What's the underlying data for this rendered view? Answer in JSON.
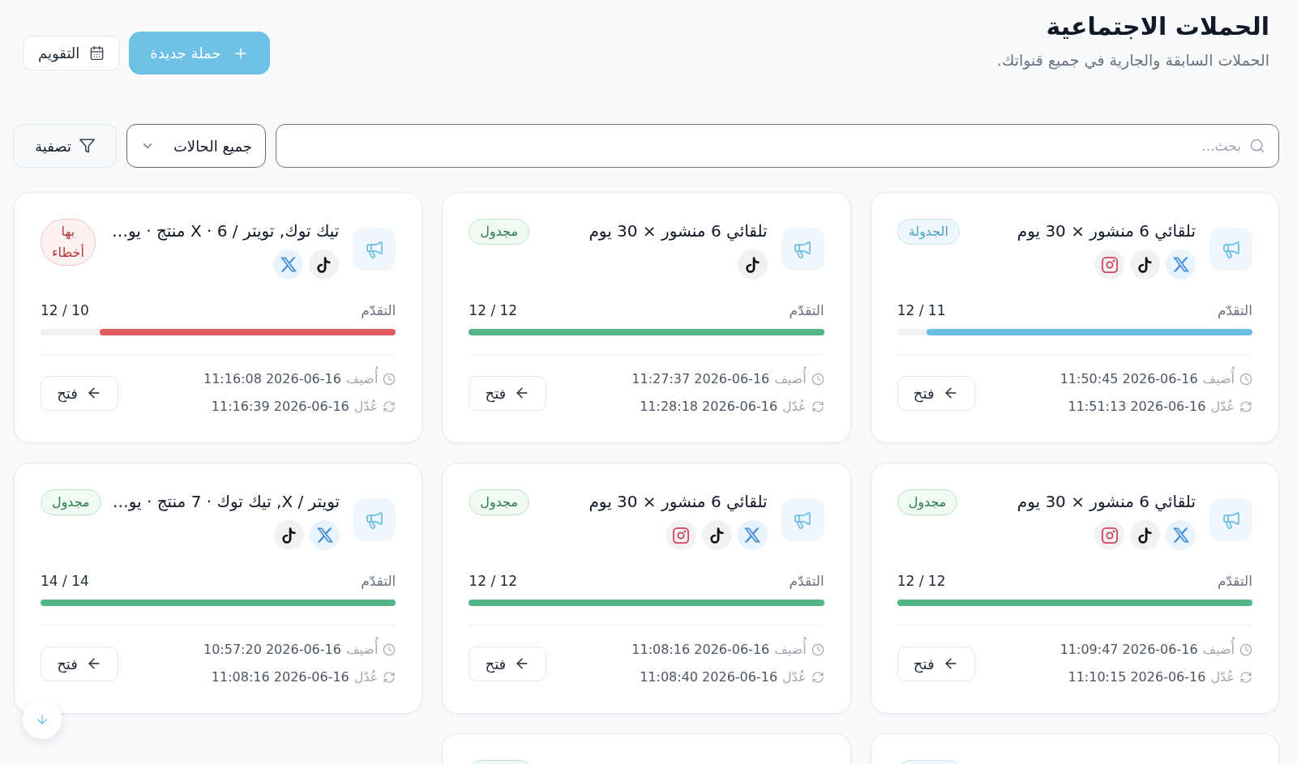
{
  "header": {
    "title": "الحملات الاجتماعية",
    "subtitle": "الحملات السابقة والجارية في جميع قنواتك.",
    "buttons": [
      {
        "kind": "primary",
        "label": "حملة جديدة"
      },
      {
        "kind": "secondary",
        "label": "التقويم"
      }
    ]
  },
  "filters": {
    "search": {
      "placeholder": "بحث..."
    },
    "status_filter": {
      "value": "جميع الحالات"
    },
    "filter_button": {
      "label": "تصفية"
    }
  },
  "cards": [
    {
      "title": "تلقائي 6 منشور × 30 يوم",
      "channels": [
        {
          "kind": "x"
        },
        {
          "kind": "tiktok"
        },
        {
          "kind": "instagram"
        }
      ],
      "status": {
        "kind": "scheduling",
        "label": "الجدولة"
      },
      "progress": {
        "label": "التقدّم",
        "value": "11 / 12",
        "level": 0.917
      },
      "created": {
        "label": "أُضيف",
        "value": "2026-06-16 11:50:45"
      },
      "updated": {
        "label": "عُدّل",
        "value": "2026-06-16 11:51:13"
      },
      "open_button": {
        "label": "فتح"
      }
    },
    {
      "title": "تلقائي 6 منشور × 30 يوم",
      "channels": [
        {
          "kind": "tiktok"
        }
      ],
      "status": {
        "kind": "scheduled",
        "label": "مجدول"
      },
      "progress": {
        "label": "التقدّم",
        "value": "12 / 12",
        "level": 1
      },
      "created": {
        "label": "أُضيف",
        "value": "2026-06-16 11:27:37"
      },
      "updated": {
        "label": "عُدّل",
        "value": "2026-06-16 11:28:18"
      },
      "open_button": {
        "label": "فتح"
      }
    },
    {
      "title": "تيك توك, تويتر / X · 6 منتج · يو…",
      "channels": [
        {
          "kind": "tiktok"
        },
        {
          "kind": "x"
        }
      ],
      "status": {
        "kind": "error",
        "label": "بها أخطاء"
      },
      "progress": {
        "label": "التقدّم",
        "value": "10 / 12",
        "level": 0.833
      },
      "created": {
        "label": "أُضيف",
        "value": "2026-06-16 11:16:08"
      },
      "updated": {
        "label": "عُدّل",
        "value": "2026-06-16 11:16:39"
      },
      "open_button": {
        "label": "فتح"
      }
    },
    {
      "title": "تلقائي 6 منشور × 30 يوم",
      "channels": [
        {
          "kind": "x"
        },
        {
          "kind": "tiktok"
        },
        {
          "kind": "instagram"
        }
      ],
      "status": {
        "kind": "scheduled",
        "label": "مجدول"
      },
      "progress": {
        "label": "التقدّم",
        "value": "12 / 12",
        "level": 1
      },
      "created": {
        "label": "أُضيف",
        "value": "2026-06-16 11:09:47"
      },
      "updated": {
        "label": "عُدّل",
        "value": "2026-06-16 11:10:15"
      },
      "open_button": {
        "label": "فتح"
      }
    },
    {
      "title": "تلقائي 6 منشور × 30 يوم",
      "channels": [
        {
          "kind": "x"
        },
        {
          "kind": "tiktok"
        },
        {
          "kind": "instagram"
        }
      ],
      "status": {
        "kind": "scheduled",
        "label": "مجدول"
      },
      "progress": {
        "label": "التقدّم",
        "value": "12 / 12",
        "level": 1
      },
      "created": {
        "label": "أُضيف",
        "value": "2026-06-16 11:08:16"
      },
      "updated": {
        "label": "عُدّل",
        "value": "2026-06-16 11:08:40"
      },
      "open_button": {
        "label": "فتح"
      }
    },
    {
      "title": "تويتر / X, تيك توك · 7 منتج · يو…",
      "channels": [
        {
          "kind": "x"
        },
        {
          "kind": "tiktok"
        }
      ],
      "status": {
        "kind": "scheduled",
        "label": "مجدول"
      },
      "progress": {
        "label": "التقدّم",
        "value": "14 / 14",
        "level": 1
      },
      "created": {
        "label": "أُضيف",
        "value": "2026-06-16 10:57:20"
      },
      "updated": {
        "label": "عُدّل",
        "value": "2026-06-16 11:08:16"
      },
      "open_button": {
        "label": "فتح"
      }
    },
    {
      "status": {
        "kind": "scheduling"
      }
    },
    {
      "status": {
        "kind": "scheduled"
      }
    }
  ]
}
